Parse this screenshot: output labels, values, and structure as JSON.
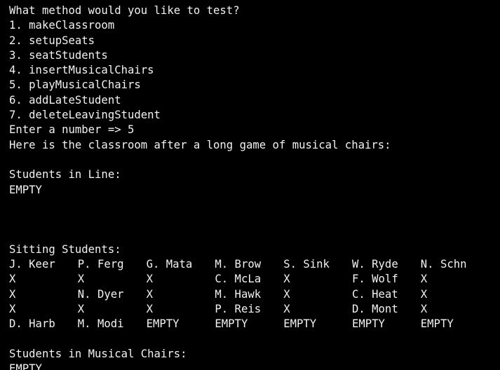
{
  "terminal": {
    "prompt": "What method would you like to test?",
    "menu": [
      "1. makeClassroom",
      "2. setupSeats",
      "3. seatStudents",
      "4. insertMusicalChairs",
      "5. playMusicalChairs",
      "6. addLateStudent",
      "7. deleteLeavingStudent"
    ],
    "entry": "Enter a number => 5",
    "result_header": "Here is the classroom after a long game of musical chairs:",
    "line_heading": "Students in Line:",
    "line_value": "EMPTY",
    "sitting_heading": "Sitting Students:",
    "seats": [
      [
        "J. Keer",
        "P. Ferg",
        "G. Mata",
        "M. Brow",
        "S. Sink",
        "W. Ryde",
        "N. Schn"
      ],
      [
        "X",
        "X",
        "X",
        "C. McLa",
        "X",
        "F. Wolf",
        "X"
      ],
      [
        "X",
        "N. Dyer",
        "X",
        "M. Hawk",
        "X",
        "C. Heat",
        "X"
      ],
      [
        "X",
        "X",
        "X",
        "P. Reis",
        "X",
        "D. Mont",
        "X"
      ],
      [
        "D. Harb",
        "M. Modi",
        "EMPTY",
        "EMPTY",
        "EMPTY",
        "EMPTY",
        "EMPTY"
      ]
    ],
    "musical_heading": "Students in Musical Chairs:",
    "musical_value": "EMPTY"
  },
  "colors": {
    "background": "#000000",
    "text": "#f2f2f2"
  }
}
